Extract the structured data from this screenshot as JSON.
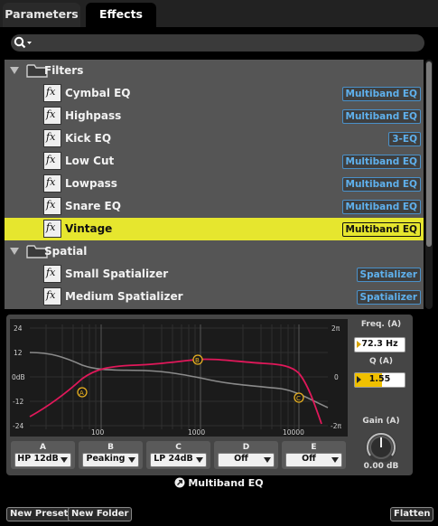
{
  "tabs": [
    {
      "label": "Parameters",
      "active": false
    },
    {
      "label": "Effects",
      "active": true
    }
  ],
  "search": {
    "icon": "search-icon",
    "value": ""
  },
  "list": {
    "groups": [
      {
        "name": "Filters",
        "expanded": true,
        "items": [
          {
            "label": "Cymbal EQ",
            "badge": "Multiband EQ"
          },
          {
            "label": "Highpass",
            "badge": "Multiband EQ"
          },
          {
            "label": "Kick EQ",
            "badge": "3-EQ"
          },
          {
            "label": "Low Cut",
            "badge": "Multiband EQ"
          },
          {
            "label": "Lowpass",
            "badge": "Multiband EQ"
          },
          {
            "label": "Snare EQ",
            "badge": "Multiband EQ"
          },
          {
            "label": "Vintage",
            "badge": "Multiband EQ",
            "selected": true
          }
        ]
      },
      {
        "name": "Spatial",
        "expanded": true,
        "items": [
          {
            "label": "Small Spatializer",
            "badge": "Spatializer"
          },
          {
            "label": "Medium Spatializer",
            "badge": "Spatializer"
          }
        ]
      }
    ]
  },
  "eq": {
    "y_ticks": [
      "24",
      "12",
      "0dB",
      "-12",
      "-24"
    ],
    "x_ticks": [
      "100",
      "1000",
      "10000"
    ],
    "right_ticks": [
      "2π",
      "0",
      "-2π"
    ],
    "markers": [
      "A",
      "B",
      "C"
    ],
    "freq": {
      "label": "Freq. (A)",
      "value": "72.3 Hz"
    },
    "q": {
      "label": "Q (A)",
      "value": "1.55",
      "fill": 0.55
    },
    "gain": {
      "label": "Gain (A)",
      "value": "0.00 dB"
    },
    "bands": [
      {
        "name": "A",
        "type": "HP 12dB"
      },
      {
        "name": "B",
        "type": "Peaking"
      },
      {
        "name": "C",
        "type": "LP 24dB"
      },
      {
        "name": "D",
        "type": "Off"
      },
      {
        "name": "E",
        "type": "Off"
      }
    ]
  },
  "effect_title": "Multiband EQ",
  "footer": {
    "new_preset": "New Preset",
    "new_folder": "New Folder",
    "flatten": "Flatten"
  },
  "colors": {
    "selection": "#e6e62e",
    "badge": "#5fb0ec",
    "curve": "#e0185a",
    "marker": "#e8b020"
  }
}
